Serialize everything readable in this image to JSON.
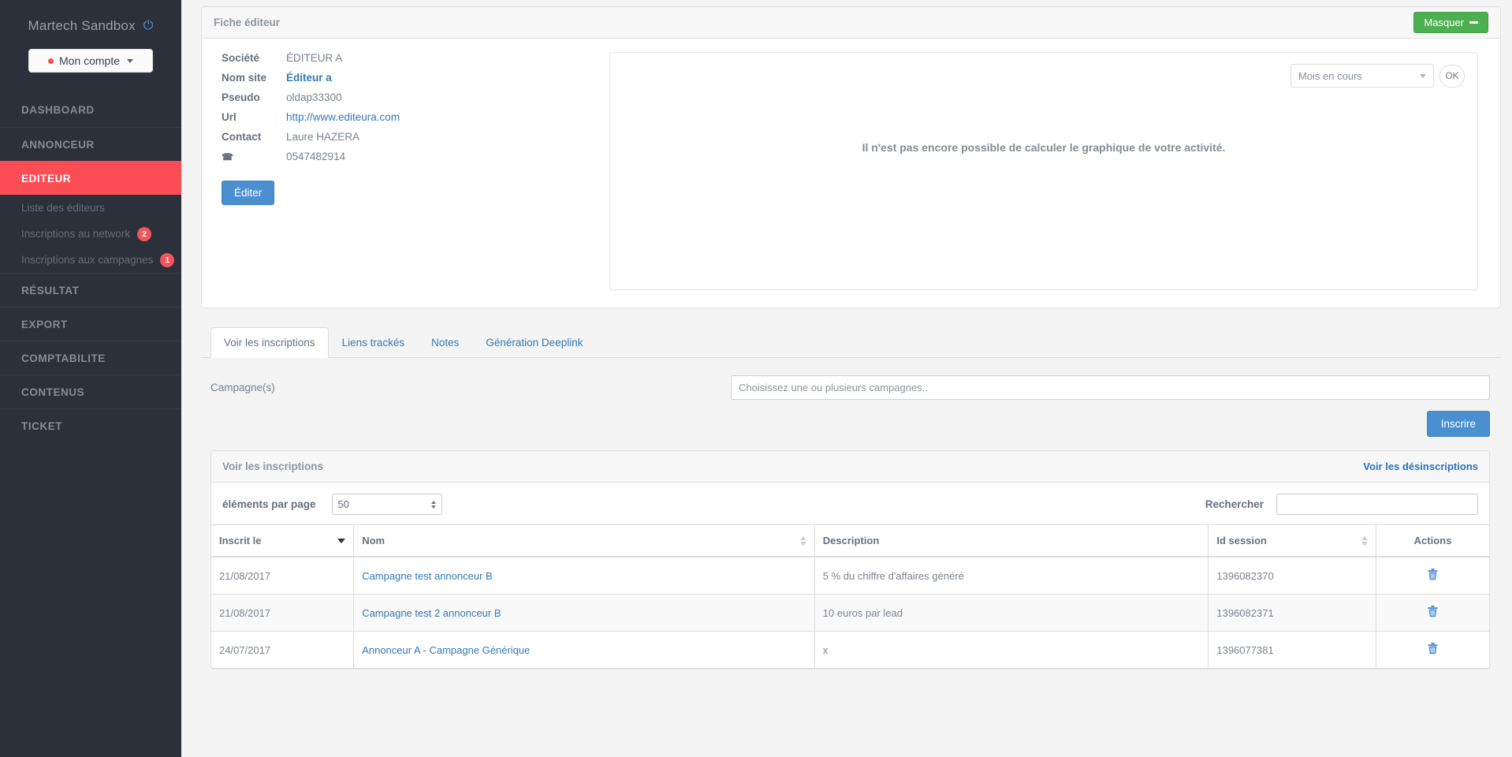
{
  "sidebar": {
    "brand": "Martech Sandbox",
    "power_icon": "power-icon",
    "account_button": "Mon compte",
    "nav": [
      {
        "label": "DASHBOARD",
        "active": false
      },
      {
        "label": "ANNONCEUR",
        "active": false
      },
      {
        "label": "EDITEUR",
        "active": true
      },
      {
        "label": "RÉSULTAT",
        "active": false
      },
      {
        "label": "EXPORT",
        "active": false
      },
      {
        "label": "COMPTABILITE",
        "active": false
      },
      {
        "label": "CONTENUS",
        "active": false
      },
      {
        "label": "TICKET",
        "active": false
      }
    ],
    "sub_items": [
      {
        "label": "Liste des éditeurs",
        "badge": ""
      },
      {
        "label": "Inscriptions au network",
        "badge": "2"
      },
      {
        "label": "Inscriptions aux campagnes",
        "badge": "1"
      }
    ],
    "colors": {
      "background": "#2b303b",
      "active": "#fc4c54",
      "badge": "#f4555c",
      "power": "#4a90d9"
    }
  },
  "fiche": {
    "panel_title": "Fiche éditeur",
    "hide_button": "Masquer",
    "fields": [
      {
        "label": "Société",
        "value": "ÉDITEUR A",
        "style": "plain"
      },
      {
        "label": "Nom site",
        "value": "Éditeur a",
        "style": "bold-link"
      },
      {
        "label": "Pseudo",
        "value": "oldap33300",
        "style": "plain"
      },
      {
        "label": "Url",
        "value": "http://www.editeura.com",
        "style": "link"
      },
      {
        "label": "Contact",
        "value": "Laure HAZERA",
        "style": "plain"
      },
      {
        "label": "phone-icon",
        "value": "0547482914",
        "style": "plain"
      }
    ],
    "edit_button": "Éditer"
  },
  "chart_area": {
    "period_select": "Mois en cours",
    "ok_button": "OK",
    "message": "Il n'est pas encore possible de calculer le graphique de votre activité."
  },
  "tabs": [
    {
      "label": "Voir les inscriptions",
      "active": true
    },
    {
      "label": "Liens trackés",
      "active": false
    },
    {
      "label": "Notes",
      "active": false
    },
    {
      "label": "Génération Deeplink",
      "active": false
    }
  ],
  "campaign_form": {
    "label": "Campagne(s)",
    "placeholder": "Choisissez une ou plusieurs campagnes..",
    "value": "",
    "submit_button": "Inscrire"
  },
  "inscriptions": {
    "panel_title": "Voir les inscriptions",
    "desinscriptions_link": "Voir les désinscriptions",
    "per_page_label": "éléments par page",
    "per_page_value": "50",
    "search_label": "Rechercher",
    "search_value": "",
    "columns": [
      {
        "label": "Inscrit le",
        "sort": "desc"
      },
      {
        "label": "Nom",
        "sort": "both"
      },
      {
        "label": "Description",
        "sort": "none"
      },
      {
        "label": "Id session",
        "sort": "both"
      },
      {
        "label": "Actions",
        "sort": "none"
      }
    ],
    "rows": [
      {
        "date": "21/08/2017",
        "nom": "Campagne test annonceur B",
        "description": "5 % du chiffre d'affaires généré",
        "id_session": "1396082370",
        "action_icon": "trash-icon"
      },
      {
        "date": "21/08/2017",
        "nom": "Campagne test 2 annonceur B",
        "description": "10 euros par lead",
        "id_session": "1396082371",
        "action_icon": "trash-icon"
      },
      {
        "date": "24/07/2017",
        "nom": "Annonceur A - Campagne Générique",
        "description": "x",
        "id_session": "1396077381",
        "action_icon": "trash-icon"
      }
    ]
  }
}
